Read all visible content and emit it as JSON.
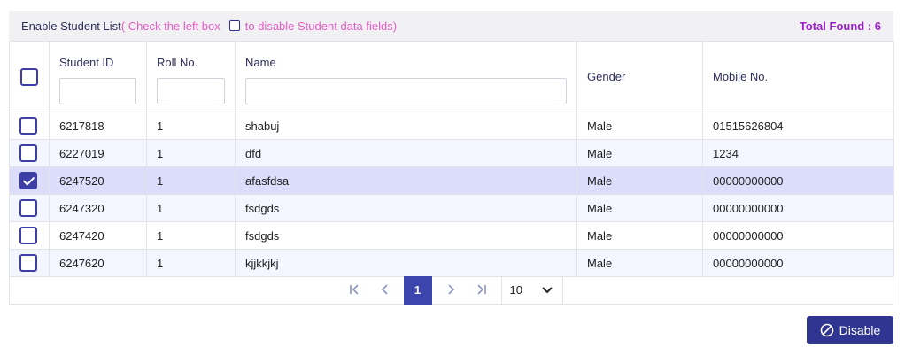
{
  "header": {
    "title": "Enable Student List",
    "hint_before": "( Check the left box",
    "hint_after": "to disable Student data fields)",
    "total": "Total Found : 6"
  },
  "columns": {
    "student_id": "Student ID",
    "roll_no": "Roll No.",
    "name": "Name",
    "gender": "Gender",
    "mobile": "Mobile No."
  },
  "rows": [
    {
      "student_id": "6217818",
      "roll": "1",
      "name": "shabuj",
      "gender": "Male",
      "mobile": "01515626804",
      "checked": false
    },
    {
      "student_id": "6227019",
      "roll": "1",
      "name": "dfd",
      "gender": "Male",
      "mobile": "1234",
      "checked": false
    },
    {
      "student_id": "6247520",
      "roll": "1",
      "name": "afasfdsa",
      "gender": "Male",
      "mobile": "00000000000",
      "checked": true
    },
    {
      "student_id": "6247320",
      "roll": "1",
      "name": "fsdgds",
      "gender": "Male",
      "mobile": "00000000000",
      "checked": false
    },
    {
      "student_id": "6247420",
      "roll": "1",
      "name": "fsdgds",
      "gender": "Male",
      "mobile": "00000000000",
      "checked": false
    },
    {
      "student_id": "6247620",
      "roll": "1",
      "name": "kjjkkjkj",
      "gender": "Male",
      "mobile": "00000000000",
      "checked": false
    }
  ],
  "pager": {
    "first": "|‹",
    "prev": "‹",
    "current_page": "1",
    "next": "›",
    "last": "›|",
    "page_size": "10"
  },
  "actions": {
    "disable_label": "Disable"
  },
  "colors": {
    "accent": "#3c44ad",
    "selected_row": "#dcdcfb",
    "hint": "#e45cc5",
    "total": "#9c1fc7"
  }
}
